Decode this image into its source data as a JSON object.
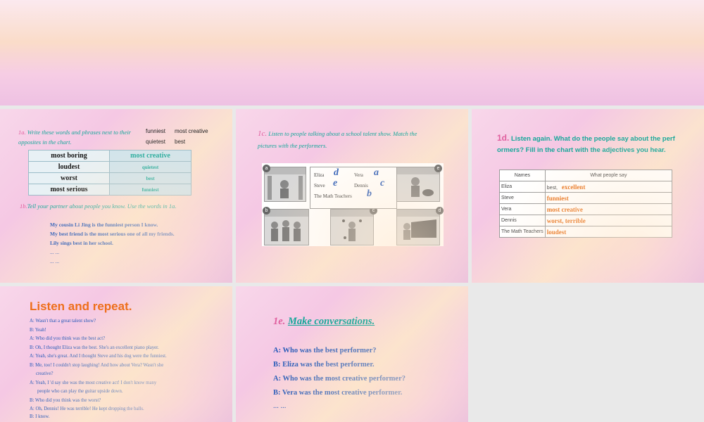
{
  "slide1": {
    "num": "1a.",
    "instruction_line1": "Write these words and phrases next to their",
    "instruction_line2": "opposites in the chart.",
    "word_bank": [
      "funniest",
      "most creative",
      "quietest",
      "best"
    ],
    "table": [
      {
        "left": "most boring",
        "right": "most creative"
      },
      {
        "left": "loudest",
        "right": "quietest"
      },
      {
        "left": "worst",
        "right": "best"
      },
      {
        "left": "most serious",
        "right": "funniest"
      }
    ],
    "num2": "1b.",
    "instruction2": "Tell your partner about people you know. Use the words in 1a.",
    "examples": [
      "My cousin Li Jing is the funniest person I know.",
      "My best friend is the most serious one of all my friends.",
      "Lily sings best in her school.",
      "... ...",
      "... ..."
    ]
  },
  "slide2": {
    "num": "1c.",
    "instruction_line1": "Listen to people talking about a school talent show. Match the",
    "instruction_line2": "pictures with the performers.",
    "picture_labels": [
      "a",
      "b",
      "c",
      "d",
      "e"
    ],
    "names": [
      {
        "name": "Eliza",
        "answer": "d"
      },
      {
        "name": "Vera",
        "answer": "a"
      },
      {
        "name": "Steve",
        "answer": "e"
      },
      {
        "name": "Dennis",
        "answer": "c"
      },
      {
        "name": "The Math Teachers",
        "answer": "b"
      }
    ]
  },
  "slide3": {
    "num": "1d.",
    "instruction_line1": "Listen again. What do the people say about the perf",
    "instruction_line2": "ormers? Fill in the chart with the adjectives you hear.",
    "col_names": "Names",
    "col_what": "What people say",
    "rows": [
      {
        "name": "Eliza",
        "prefix": "best,",
        "answer": "excellent"
      },
      {
        "name": "Steve",
        "prefix": "",
        "answer": "funniest"
      },
      {
        "name": "Vera",
        "prefix": "",
        "answer": "most creative"
      },
      {
        "name": "Dennis",
        "prefix": "",
        "answer": "worst, terrible"
      },
      {
        "name": "The Math Teachers",
        "prefix": "",
        "answer": "loudest"
      }
    ]
  },
  "slide4": {
    "title": "Listen and repeat.",
    "lines": [
      "A: Wasn't that a great talent show?",
      "B: Yeah!",
      "A: Who did you think was the best act?",
      "B: Oh, I thought Eliza was the best. She's an excellent piano player.",
      "A: Yeah, she's great. And I thought Steve and his dog were the funniest.",
      "B: Me, too! I couldn't stop laughing! And how about Vera? Wasn't she",
      "creative?",
      "A: Yeah, I 'd say she was the most creative act! I don't know many",
      "people who can play the guitar upside down.",
      "B: Who did you think was the worst?",
      "A: Oh, Dennis! He was terrible! He kept dropping the balls.",
      "B: I know."
    ]
  },
  "slide5": {
    "num": "1e.",
    "title": "Make conversations.",
    "lines": [
      "A: Who was the best performer?",
      "B: Eliza was the best performer.",
      "A: Who was the most creative performer?",
      "B: Vera was the most creative performer.",
      "... ..."
    ]
  }
}
